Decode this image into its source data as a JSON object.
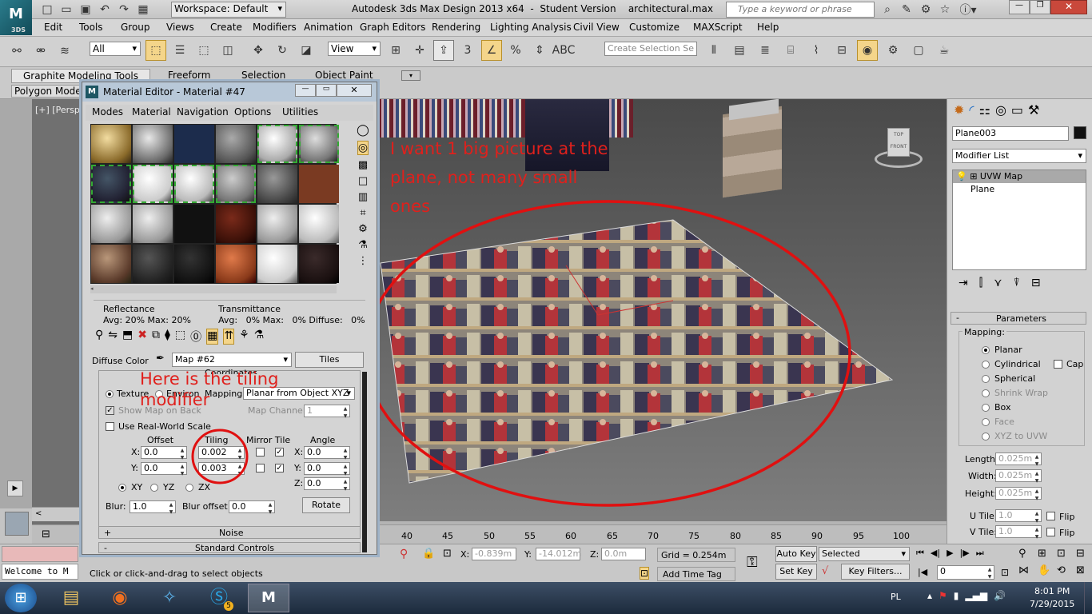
{
  "titlebar": {
    "workspace": "Workspace: Default",
    "title": "Autodesk 3ds Max Design 2013 x64  -  Student Version    architectural.max",
    "search_placeholder": "Type a keyword or phrase"
  },
  "menubar": [
    "Edit",
    "Tools",
    "Group",
    "Views",
    "Create",
    "Modifiers",
    "Animation",
    "Graph Editors",
    "Rendering",
    "Lighting Analysis",
    "Civil View",
    "Customize",
    "MAXScript",
    "Help"
  ],
  "maintoolbar": {
    "filter": "All",
    "refcoord": "View",
    "selset_placeholder": "Create Selection Se"
  },
  "ribbon": {
    "tabs": [
      "Graphite Modeling Tools",
      "Freeform",
      "Selection",
      "Object Paint"
    ],
    "sub": "Polygon Model"
  },
  "viewport": {
    "label": "[+] [Persp",
    "annotation1": "I want 1 big picture at the plane, not many small ones",
    "viewcube_top": "TOP",
    "viewcube_front": "FRONT"
  },
  "mated": {
    "title": "Material Editor - Material #47",
    "menus": [
      "Modes",
      "Material",
      "Navigation",
      "Options",
      "Utilities"
    ],
    "reflectance_label": "Reflectance",
    "reflectance_vals": "Avg: 20% Max: 20%",
    "transmittance_label": "Transmittance",
    "transmittance_vals": "Avg:   0% Max:   0% Diffuse:   0%",
    "diffuse_label": "Diffuse Color",
    "map_name": "Map #62",
    "map_type": "Tiles",
    "coords_header": "Coordinates",
    "texture": "Texture",
    "environ": "Environ",
    "mapping_label": "Mapping:",
    "mapping_val": "Planar from Object XYZ",
    "show_map": "Show Map on Back",
    "map_channel_label": "Map Channel:",
    "map_channel": "1",
    "real_world": "Use Real-World Scale",
    "offset_h": "Offset",
    "tiling_h": "Tiling",
    "mirror_h": "Mirror Tile",
    "angle_h": "Angle",
    "x": "X:",
    "y": "Y:",
    "z": "Z:",
    "offset_x": "0.0",
    "offset_y": "0.0",
    "tiling_x": "0.002",
    "tiling_y": "0.003",
    "angle_x": "0.0",
    "angle_y": "0.0",
    "angle_z": "0.0",
    "xy": "XY",
    "yz": "YZ",
    "zx": "ZX",
    "blur_label": "Blur:",
    "blur": "1.0",
    "blur_off_label": "Blur offset:",
    "blur_off": "0.0",
    "rotate": "Rotate",
    "noise": "Noise",
    "standard": "Standard Controls",
    "plus": "+",
    "minus": "-",
    "annotation2": "Here is the tiling modifier"
  },
  "cmdpanel": {
    "object_name": "Plane003",
    "modifier_list": "Modifier List",
    "stack": [
      "UVW Map",
      "Plane"
    ],
    "params_header": "Parameters",
    "mapping_label": "Mapping:",
    "map_types": [
      "Planar",
      "Cylindrical",
      "Spherical",
      "Shrink Wrap",
      "Box",
      "Face",
      "XYZ to UVW"
    ],
    "cap": "Cap",
    "length_label": "Length:",
    "length": "0.025m",
    "width_label": "Width:",
    "width": "0.025m",
    "height_label": "Height:",
    "height": "0.025m",
    "utile_label": "U Tile:",
    "utile": "1.0",
    "vtile_label": "V Tile:",
    "vtile": "1.0",
    "flip": "Flip"
  },
  "timeline": {
    "ticks": [
      "40",
      "45",
      "50",
      "55",
      "60",
      "65",
      "70",
      "75",
      "80",
      "85",
      "90",
      "95",
      "100"
    ]
  },
  "status": {
    "maxscript": "Welcome to M",
    "prompt": "Click or click-and-drag to select objects",
    "x_label": "X:",
    "x": "-0.839m",
    "y_label": "Y:",
    "y": "-14.012m",
    "z_label": "Z:",
    "z": "0.0m",
    "grid": "Grid = 0.254m",
    "add_time_tag": "Add Time Tag",
    "auto_key": "Auto Key",
    "set_key": "Set Key",
    "selected": "Selected",
    "key_filters": "Key Filters...",
    "frame": "0"
  },
  "taskbar": {
    "lang": "PL",
    "time": "8:01 PM",
    "date": "7/29/2015",
    "badge": "5"
  }
}
